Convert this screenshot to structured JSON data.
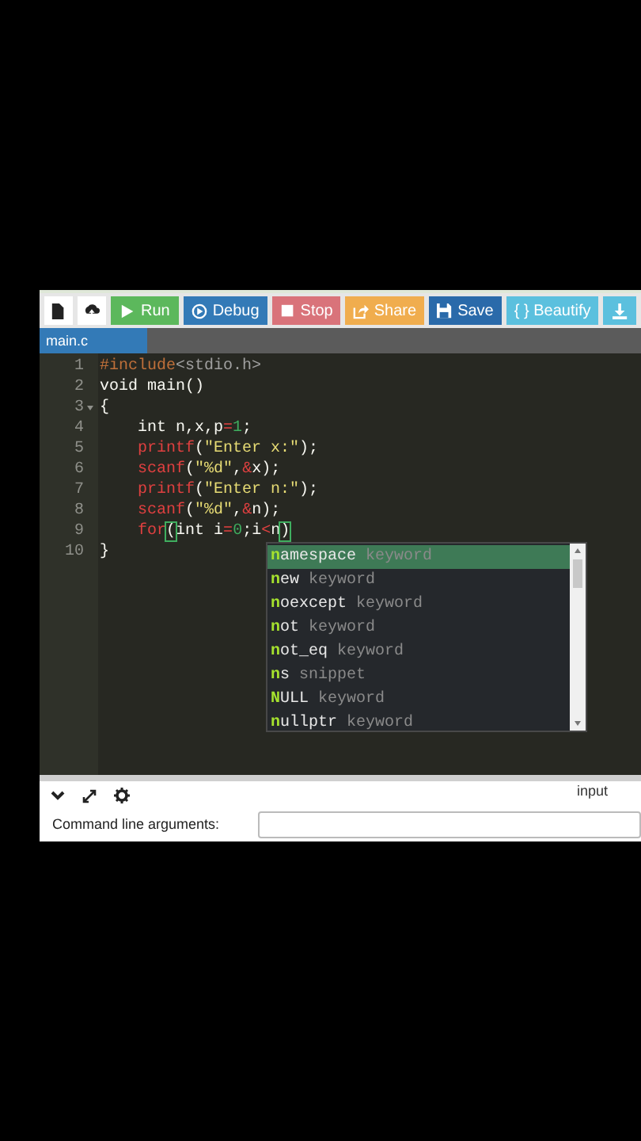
{
  "toolbar": [
    {
      "kind": "new-file"
    },
    {
      "kind": "upload"
    },
    {
      "kind": "run",
      "label": "Run"
    },
    {
      "kind": "debug",
      "label": "Debug"
    },
    {
      "kind": "stop",
      "label": "Stop"
    },
    {
      "kind": "share",
      "label": "Share"
    },
    {
      "kind": "save",
      "label": "Save"
    },
    {
      "kind": "beautify",
      "label": "{ } Beautify"
    },
    {
      "kind": "download"
    }
  ],
  "tabs": [
    {
      "label": "main.c",
      "selected": true
    }
  ],
  "editor": {
    "lines": [
      {
        "number": "1",
        "tokens": [
          {
            "kind": "directive",
            "text": "#include"
          },
          {
            "kind": "header",
            "text": "<stdio.h>"
          }
        ]
      },
      {
        "number": "2",
        "tokens": [
          {
            "kind": "plain",
            "text": "void main()"
          }
        ]
      },
      {
        "number": "3",
        "fold": true,
        "tokens": [
          {
            "kind": "plain",
            "text": "{"
          }
        ]
      },
      {
        "number": "4",
        "indent": true,
        "tokens": [
          {
            "kind": "plain",
            "text": "int n,x,p"
          },
          {
            "kind": "operator",
            "text": "="
          },
          {
            "kind": "number",
            "text": "1"
          },
          {
            "kind": "plain",
            "text": ";"
          }
        ]
      },
      {
        "number": "5",
        "indent": true,
        "tokens": [
          {
            "kind": "func",
            "text": "printf"
          },
          {
            "kind": "plain",
            "text": "("
          },
          {
            "kind": "string",
            "text": "\"Enter x:\""
          },
          {
            "kind": "plain",
            "text": ");"
          }
        ]
      },
      {
        "number": "6",
        "indent": true,
        "tokens": [
          {
            "kind": "func",
            "text": "scanf"
          },
          {
            "kind": "plain",
            "text": "("
          },
          {
            "kind": "string",
            "text": "\"%d\""
          },
          {
            "kind": "plain",
            "text": ","
          },
          {
            "kind": "operator",
            "text": "&"
          },
          {
            "kind": "plain",
            "text": "x);"
          }
        ]
      },
      {
        "number": "7",
        "indent": true,
        "tokens": [
          {
            "kind": "func",
            "text": "printf"
          },
          {
            "kind": "plain",
            "text": "("
          },
          {
            "kind": "string",
            "text": "\"Enter n:\""
          },
          {
            "kind": "plain",
            "text": ");"
          }
        ]
      },
      {
        "number": "8",
        "indent": true,
        "tokens": [
          {
            "kind": "func",
            "text": "scanf"
          },
          {
            "kind": "plain",
            "text": "("
          },
          {
            "kind": "string",
            "text": "\"%d\""
          },
          {
            "kind": "plain",
            "text": ","
          },
          {
            "kind": "operator",
            "text": "&"
          },
          {
            "kind": "plain",
            "text": "n);"
          }
        ]
      },
      {
        "number": "9",
        "indent": true,
        "tokens": [
          {
            "kind": "func",
            "text": "for"
          },
          {
            "kind": "match",
            "text": "("
          },
          {
            "kind": "plain",
            "text": "int i"
          },
          {
            "kind": "operator",
            "text": "="
          },
          {
            "kind": "number",
            "text": "0"
          },
          {
            "kind": "plain",
            "text": ";i"
          },
          {
            "kind": "operator",
            "text": "<"
          },
          {
            "kind": "plain",
            "text": "n"
          },
          {
            "kind": "match",
            "text": ")"
          }
        ]
      },
      {
        "number": "10",
        "tokens": [
          {
            "kind": "plain",
            "text": "}"
          }
        ]
      }
    ]
  },
  "autocomplete": [
    {
      "name": "**n**amespace",
      "type": "keyword",
      "selected": true
    },
    {
      "name": "**n**ew",
      "type": "keyword",
      "selected": false
    },
    {
      "name": "**n**oexcept",
      "type": "keyword",
      "selected": false
    },
    {
      "name": "**n**ot",
      "type": "keyword",
      "selected": false
    },
    {
      "name": "**n**ot_eq",
      "type": "keyword",
      "selected": false
    },
    {
      "name": "**n**s",
      "type": "snippet",
      "selected": false
    },
    {
      "name": "**N**ULL",
      "type": "keyword",
      "selected": false
    },
    {
      "name": "**n**ullptr",
      "type": "keyword",
      "selected": false
    }
  ],
  "bottom_panel": {
    "input_label": "input",
    "args_label": "Command line arguments:"
  }
}
